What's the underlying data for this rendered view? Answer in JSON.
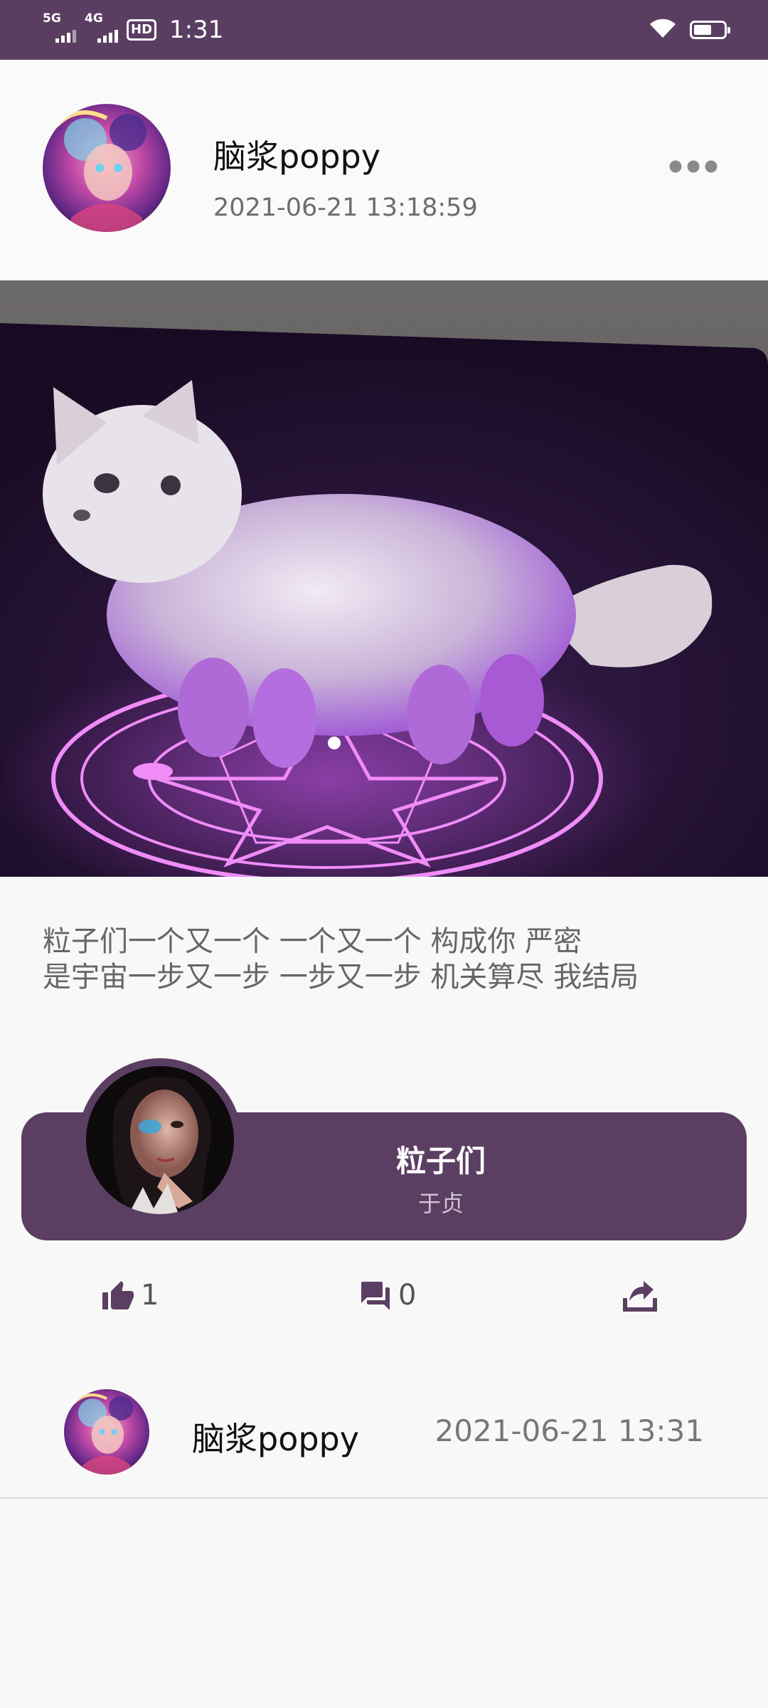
{
  "status_bar": {
    "network_1": "5G",
    "network_2": "4G",
    "hd_label": "HD",
    "time": "1:31",
    "battery_level": 0.6
  },
  "post": {
    "author": "脑浆poppy",
    "timestamp": "2021-06-21 13:18:59",
    "caption_lines": [
      "粒子们一个又一个 一个又一个 构成你 严密",
      "是宇宙一步又一步 一步又一步 机关算尽 我结局"
    ]
  },
  "music": {
    "title": "粒子们",
    "artist": "于贞"
  },
  "actions": {
    "like_count": "1",
    "comment_count": "0"
  },
  "comment": {
    "author": "脑浆poppy",
    "time": "2021-06-21 13:31"
  },
  "colors": {
    "brand": "#5b3f62",
    "status_bar": "#5a3e62",
    "background": "#f8f8f8"
  },
  "icons": {
    "more": "more-dots-icon",
    "like": "thumbs-up-icon",
    "comment": "comment-icon",
    "share": "share-icon",
    "wifi": "wifi-icon",
    "battery": "battery-icon"
  }
}
